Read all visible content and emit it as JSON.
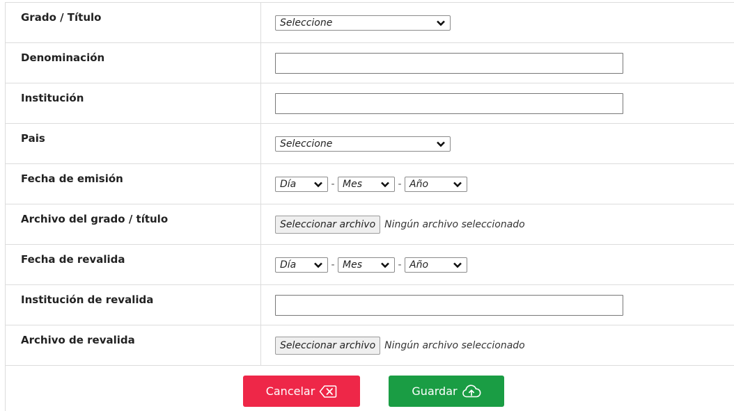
{
  "form": {
    "rows": [
      {
        "label": "Grado / Título",
        "value": "Seleccione"
      },
      {
        "label": "Denominación",
        "value": ""
      },
      {
        "label": "Institución",
        "value": ""
      },
      {
        "label": "Pais",
        "value": "Seleccione"
      },
      {
        "label": "Fecha de emisión",
        "day": "Día",
        "month": "Mes",
        "year": "Año",
        "separator": "-"
      },
      {
        "label": "Archivo del grado / título",
        "button": "Seleccionar archivo",
        "status": "Ningún archivo seleccionado"
      },
      {
        "label": "Fecha de revalida",
        "day": "Día",
        "month": "Mes",
        "year": "Año",
        "separator": "-"
      },
      {
        "label": "Institución de revalida",
        "value": ""
      },
      {
        "label": "Archivo de revalida",
        "button": "Seleccionar archivo",
        "status": "Ningún archivo seleccionado"
      }
    ]
  },
  "actions": {
    "cancel_label": "Cancelar",
    "save_label": "Guardar",
    "cancel_icon": "backspace-x-icon",
    "save_icon": "cloud-upload-icon",
    "cancel_color": "#ee2748",
    "save_color": "#1a9d44"
  }
}
